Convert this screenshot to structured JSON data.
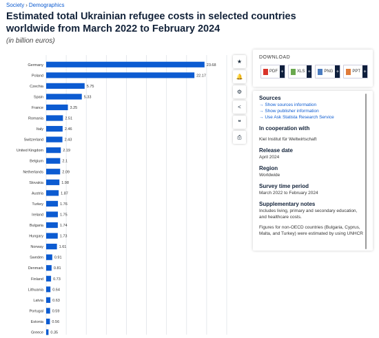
{
  "breadcrumb": {
    "part1": "Society",
    "separator": "›",
    "part2": "Demographics"
  },
  "title": "Estimated total Ukrainian refugee costs in selected countries worldwide from March 2022 to February 2024",
  "subtitle": "(in billion euros)",
  "colors": {
    "bar": "#0c5bd1",
    "grid": "#dfe3e8",
    "plus_bg": "#0e1e3c"
  },
  "toolbar": {
    "icons": [
      "star-icon",
      "bell-icon",
      "gear-icon",
      "share-icon",
      "quote-icon",
      "print-icon"
    ],
    "glyphs": [
      "★",
      "🔔",
      "⚙",
      "<",
      "❝",
      "⎙"
    ]
  },
  "download": {
    "title": "DOWNLOAD",
    "buttons": [
      {
        "label": "PDF",
        "icon": "pdf-icon",
        "color": "#d9342b",
        "plus": "+"
      },
      {
        "label": "XLS",
        "icon": "xls-icon",
        "color": "#6aa84f",
        "plus": "+"
      },
      {
        "label": "PNG",
        "icon": "png-icon",
        "color": "#4a7bbf",
        "plus": "+"
      },
      {
        "label": "PPT",
        "icon": "ppt-icon",
        "color": "#e07b39",
        "plus": "+"
      }
    ]
  },
  "info": {
    "sources_heading": "Sources",
    "links": [
      "Show sources information",
      "Show publisher information",
      "Use Ask Statista Research Service"
    ],
    "link_arrow": "→",
    "cooperation_heading": "In cooperation with",
    "cooperation_value": "Kiel Institut für Weltwirtschaft",
    "release_heading": "Release date",
    "release_value": "April 2024",
    "region_heading": "Region",
    "region_value": "Worldwide",
    "period_heading": "Survey time period",
    "period_value": "March 2022 to February 2024",
    "notes_heading": "Supplementary notes",
    "notes_value_1": "Includes living, primary and secondary education, and healthcare costs.",
    "notes_value_2": "Figures for non-OECD countries (Bulgaria, Cyprus, Malta, and Turkey) were estimated by using UNHCR"
  },
  "chart_data": {
    "type": "bar",
    "orientation": "horizontal",
    "categories": [
      "Germany",
      "Poland",
      "Czechia",
      "Spain",
      "France",
      "Romania",
      "Italy",
      "Switzerland",
      "United Kingdom",
      "Belgium",
      "Netherlands",
      "Slovakia",
      "Austria",
      "Turkey",
      "Ireland",
      "Bulgaria",
      "Hungary",
      "Norway",
      "Sweden",
      "Denmark",
      "Finland",
      "Lithuania",
      "Latvia",
      "Portugal",
      "Estonia",
      "Greece"
    ],
    "values": [
      23.68,
      22.17,
      5.75,
      5.33,
      3.25,
      2.51,
      2.46,
      2.43,
      2.19,
      2.1,
      2.09,
      1.98,
      1.87,
      1.76,
      1.75,
      1.74,
      1.73,
      1.61,
      0.91,
      0.81,
      0.73,
      0.64,
      0.63,
      0.59,
      0.56,
      0.35
    ],
    "value_labels": [
      "23.68",
      "22.17",
      "5.75",
      "5.33",
      "3.25",
      "2.51",
      "2.46",
      "2.43",
      "2.19",
      "2.1",
      "2.09",
      "1.98",
      "1.87",
      "1.76",
      "1.75",
      "1.74",
      "1.73",
      "1.61",
      "0.91",
      "0.81",
      "0.73",
      "0.64",
      "0.63",
      "0.59",
      "0.56",
      "0.35"
    ],
    "xlim": [
      0,
      27
    ],
    "grid": true,
    "legend": "none"
  }
}
